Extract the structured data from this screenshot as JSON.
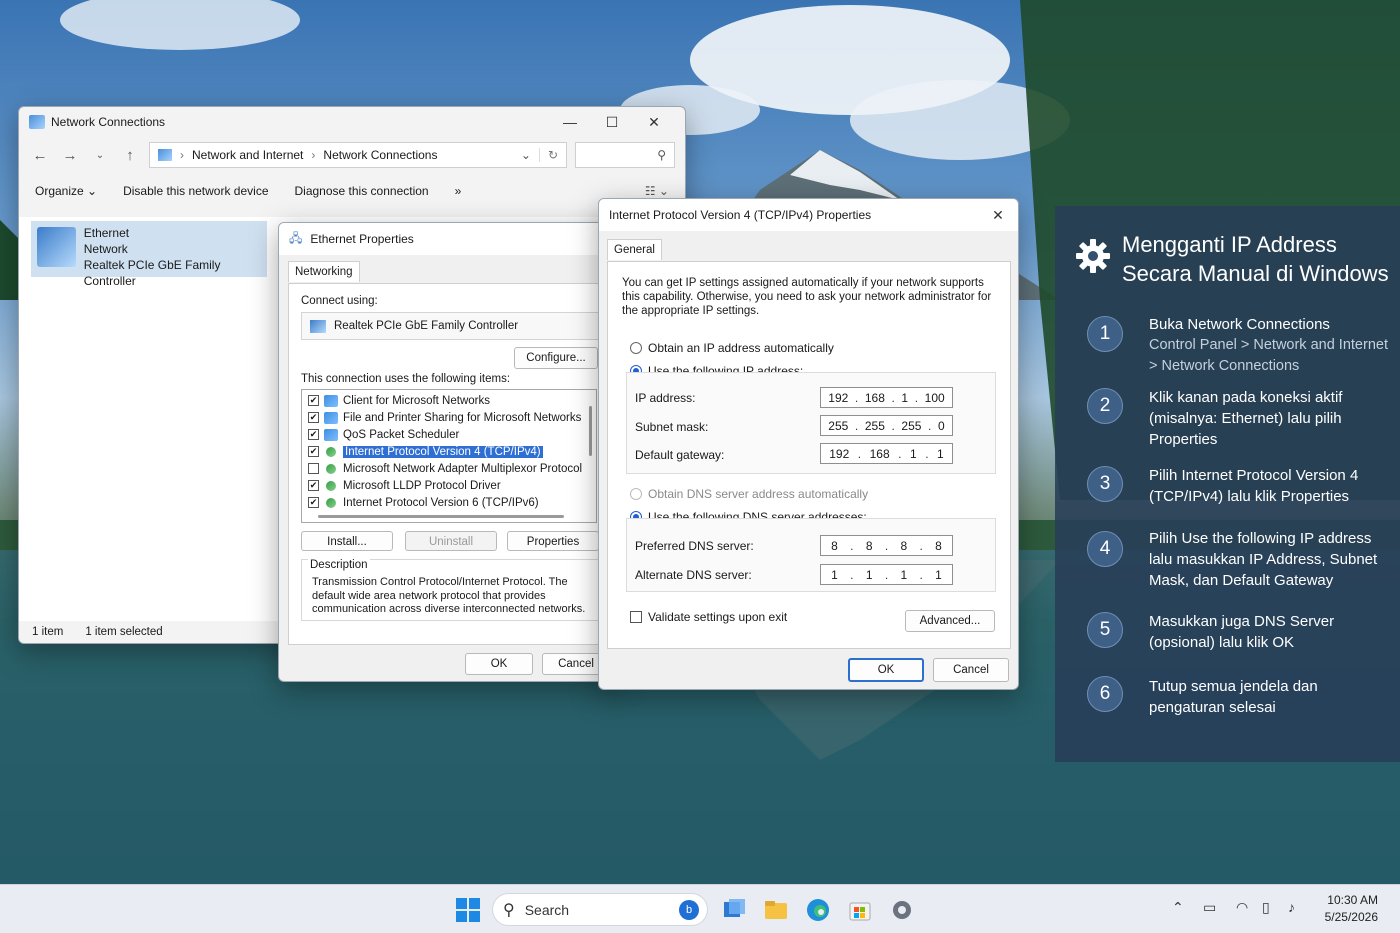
{
  "netconn": {
    "title": "Network Connections",
    "breadcrumb": [
      "Network and Internet",
      "Network Connections"
    ],
    "toolbar": [
      "Organize",
      "Disable this network device",
      "Diagnose this connection"
    ],
    "toolbar_more": "»",
    "item": {
      "name": "Ethernet",
      "type": "Network",
      "adapter": "Realtek PCIe GbE Family Controller"
    },
    "status": {
      "count": "1 item",
      "selected": "1 item selected"
    }
  },
  "ethprops": {
    "title": "Ethernet Properties",
    "tab": "Networking",
    "connect_using_label": "Connect using:",
    "adapter": "Realtek PCIe GbE Family Controller",
    "configure": "Configure...",
    "items_label": "This connection uses the following items:",
    "items": [
      {
        "label": "Client for Microsoft Networks",
        "checked": "✔"
      },
      {
        "label": "File and Printer Sharing for Microsoft Networks",
        "checked": "✔"
      },
      {
        "label": "QoS Packet Scheduler",
        "checked": "✔"
      },
      {
        "label": "Internet Protocol Version 4 (TCP/IPv4)",
        "checked": "✔"
      },
      {
        "label": "Microsoft Network Adapter Multiplexor Protocol",
        "checked": ""
      },
      {
        "label": "Microsoft LLDP Protocol Driver",
        "checked": "✔"
      },
      {
        "label": "Internet Protocol Version 6 (TCP/IPv6)",
        "checked": "✔"
      }
    ],
    "install": "Install...",
    "uninstall": "Uninstall",
    "properties": "Properties",
    "description_label": "Description",
    "description": "Transmission Control Protocol/Internet Protocol. The default wide area network protocol that provides communication across diverse interconnected networks.",
    "ok": "OK",
    "cancel": "Cancel"
  },
  "ipv4": {
    "title": "Internet Protocol Version 4 (TCP/IPv4) Properties",
    "tab": "General",
    "intro": "You can get IP settings assigned automatically if your network supports this capability. Otherwise, you need to ask your network administrator for the appropriate IP settings.",
    "auto_ip": "Obtain an IP address automatically",
    "manual_ip": "Use the following IP address:",
    "ip_label": "IP address:",
    "ip": [
      "192",
      "168",
      "1",
      "100"
    ],
    "mask_label": "Subnet mask:",
    "mask": [
      "255",
      "255",
      "255",
      "0"
    ],
    "gw_label": "Default gateway:",
    "gw": [
      "192",
      "168",
      "1",
      "1"
    ],
    "auto_dns": "Obtain DNS server address automatically",
    "manual_dns": "Use the following DNS server addresses:",
    "pdns_label": "Preferred DNS server:",
    "pdns": [
      "8",
      "8",
      "8",
      "8"
    ],
    "adns_label": "Alternate DNS server:",
    "adns": [
      "1",
      "1",
      "1",
      "1"
    ],
    "validate": "Validate settings upon exit",
    "advanced": "Advanced...",
    "ok": "OK",
    "cancel": "Cancel"
  },
  "guide": {
    "title": "Mengganti IP Address Secara Manual di Windows",
    "steps": [
      {
        "num": "1",
        "text": "Buka Network Connections",
        "sub": "Control Panel > Network and Internet > Network Connections"
      },
      {
        "num": "2",
        "text": "Klik kanan pada koneksi aktif (misalnya: Ethernet) lalu pilih Properties",
        "sub": ""
      },
      {
        "num": "3",
        "text": "Pilih Internet Protocol Version 4 (TCP/IPv4) lalu klik Properties",
        "sub": ""
      },
      {
        "num": "4",
        "text": "Pilih Use the following IP address lalu masukkan IP Address, Subnet Mask, dan Default Gateway",
        "sub": ""
      },
      {
        "num": "5",
        "text": "Masukkan juga DNS Server (opsional) lalu klik OK",
        "sub": ""
      },
      {
        "num": "6",
        "text": "Tutup semua jendela dan pengaturan selesai",
        "sub": ""
      }
    ]
  },
  "taskbar": {
    "search": "Search",
    "time": "10:30 AM",
    "date": "5/25/2026"
  },
  "colors": {
    "accent": "#2b6fd1",
    "guide_bg": "#283e58",
    "selection": "#2f6fd4"
  }
}
